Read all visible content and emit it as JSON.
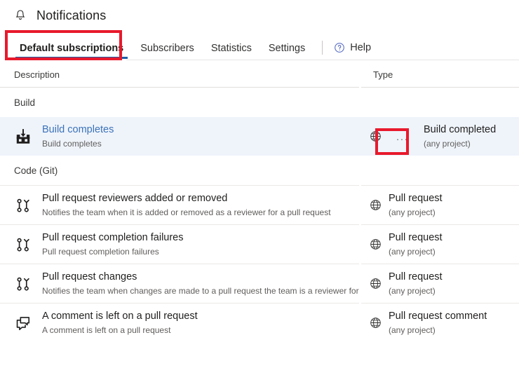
{
  "header": {
    "icon": "bell-icon",
    "title": "Notifications"
  },
  "tabs": [
    {
      "label": "Default subscriptions",
      "selected": true
    },
    {
      "label": "Subscribers",
      "selected": false
    },
    {
      "label": "Statistics",
      "selected": false
    },
    {
      "label": "Settings",
      "selected": false
    }
  ],
  "help": {
    "icon": "help-circle-icon",
    "label": "Help"
  },
  "table": {
    "columns": {
      "description": "Description",
      "type": "Type"
    },
    "groups": [
      {
        "name": "Build",
        "rows": [
          {
            "icon": "build-icon",
            "title": "Build completes",
            "subtitle": "Build completes",
            "title_is_link": true,
            "selected": true,
            "scope_icon": "globe-icon",
            "has_ellipsis": true,
            "ellipsis_label": "...",
            "type_title": "Build completed",
            "type_sub": "(any project)"
          }
        ]
      },
      {
        "name": "Code (Git)",
        "rows": [
          {
            "icon": "pull-request-icon",
            "title": "Pull request reviewers added or removed",
            "subtitle": "Notifies the team when it is added or removed as a reviewer for a pull request",
            "title_is_link": false,
            "selected": false,
            "scope_icon": "globe-icon",
            "has_ellipsis": false,
            "ellipsis_label": "",
            "type_title": "Pull request",
            "type_sub": "(any project)"
          },
          {
            "icon": "pull-request-icon",
            "title": "Pull request completion failures",
            "subtitle": "Pull request completion failures",
            "title_is_link": false,
            "selected": false,
            "scope_icon": "globe-icon",
            "has_ellipsis": false,
            "ellipsis_label": "",
            "type_title": "Pull request",
            "type_sub": "(any project)"
          },
          {
            "icon": "pull-request-icon",
            "title": "Pull request changes",
            "subtitle": "Notifies the team when changes are made to a pull request the team is a reviewer for",
            "title_is_link": false,
            "selected": false,
            "scope_icon": "globe-icon",
            "has_ellipsis": false,
            "ellipsis_label": "",
            "type_title": "Pull request",
            "type_sub": "(any project)"
          },
          {
            "icon": "comment-icon",
            "title": "A comment is left on a pull request",
            "subtitle": "A comment is left on a pull request",
            "title_is_link": false,
            "selected": false,
            "scope_icon": "globe-icon",
            "has_ellipsis": false,
            "ellipsis_label": "",
            "type_title": "Pull request comment",
            "type_sub": "(any project)"
          }
        ]
      }
    ]
  },
  "annotations": [
    {
      "name": "annotation-box-default-subscriptions-tab",
      "color": "#e8192c"
    },
    {
      "name": "annotation-box-row-context-menu",
      "color": "#e8192c"
    }
  ],
  "colors": {
    "accent_tab_underline": "#1b5ea8",
    "link": "#3b72b8",
    "selected_row_bg": "#eff4fb",
    "annotation": "#e8192c",
    "help_icon": "#5b6fc4"
  }
}
